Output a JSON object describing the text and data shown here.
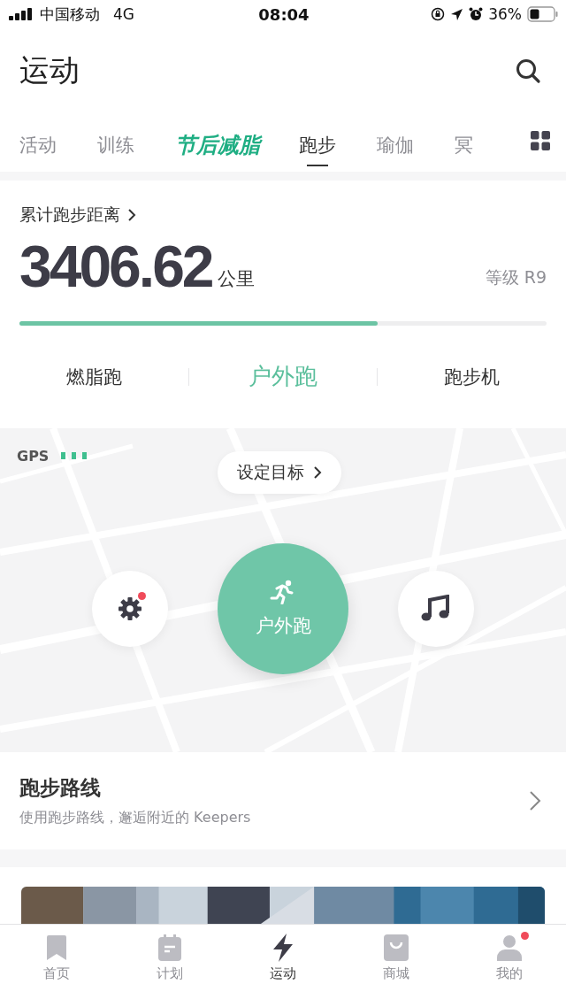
{
  "status_bar": {
    "carrier": "中国移动",
    "network": "4G",
    "time": "08:04",
    "battery": "36%"
  },
  "header": {
    "title": "运动"
  },
  "tabs": [
    {
      "label": "活动",
      "kind": "plain",
      "selected": false
    },
    {
      "label": "训练",
      "kind": "plain",
      "selected": false
    },
    {
      "label": "节后减脂",
      "kind": "promo",
      "selected": false
    },
    {
      "label": "跑步",
      "kind": "plain",
      "selected": true
    },
    {
      "label": "瑜伽",
      "kind": "plain",
      "selected": false
    },
    {
      "label": "冥",
      "kind": "plain",
      "selected": false
    }
  ],
  "summary": {
    "link": "累计跑步距离",
    "distance": "3406.62",
    "unit": "公里",
    "grade": "等级 R9",
    "level": 0.68
  },
  "modes": [
    {
      "label": "燃脂跑",
      "selected": false
    },
    {
      "label": "户外跑",
      "selected": true
    },
    {
      "label": "跑步机",
      "selected": false
    }
  ],
  "map": {
    "gps": "GPS",
    "goal": "设定目标",
    "start": "户外跑",
    "settings_badge": true
  },
  "route": {
    "title": "跑步路线",
    "subtitle": "使用跑步路线，邂逅附近的 Keepers"
  },
  "nav": [
    {
      "label": "首页",
      "kind": "bookmark",
      "selected": false,
      "badge": false
    },
    {
      "label": "计划",
      "kind": "calendar",
      "selected": false,
      "badge": false
    },
    {
      "label": "运动",
      "kind": "bolt",
      "selected": true,
      "badge": false
    },
    {
      "label": "商城",
      "kind": "bag",
      "selected": false,
      "badge": false
    },
    {
      "label": "我的",
      "kind": "person",
      "selected": false,
      "badge": true
    }
  ]
}
